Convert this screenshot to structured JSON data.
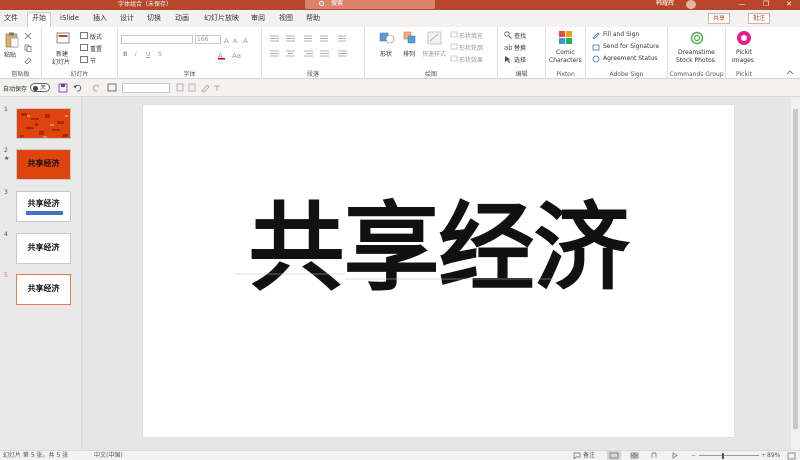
{
  "titlebar": {
    "doc_title": "字体组合（未保存）",
    "search_placeholder": "搜索",
    "user": "韩耀辉",
    "minimize": "—",
    "restore": "❐",
    "close": "✕"
  },
  "menu": {
    "tabs": [
      "文件",
      "开始",
      "iSlide",
      "插入",
      "设计",
      "切换",
      "动画",
      "幻灯片放映",
      "审阅",
      "视图",
      "帮助"
    ],
    "active_index": 1,
    "share": "共享",
    "comment": "批注"
  },
  "ribbon": {
    "clipboard": {
      "paste": "粘贴",
      "label": "剪贴板"
    },
    "slides": {
      "new_slide": "新建",
      "new_slide2": "幻灯片",
      "layout": "版式",
      "reset": "重置",
      "section": "节",
      "label": "幻灯片"
    },
    "font": {
      "size": "166",
      "bold": "B",
      "italic": "I",
      "underline": "U",
      "strike": "S",
      "label": "字体"
    },
    "paragraph": {
      "label": "段落"
    },
    "drawing": {
      "shapes": "形状",
      "arrange": "排列",
      "quick_styles": "快速样式",
      "fill": "形状填充",
      "outline": "形状轮廓",
      "effects": "形状效果",
      "label": "绘图"
    },
    "editing": {
      "find": "查找",
      "replace": "替换",
      "select": "选择",
      "label": "编辑"
    },
    "pixton": {
      "comic": "Comic",
      "characters": "Characters",
      "label": "Pixton"
    },
    "adobe_sign": {
      "fill_sign": "Fill and Sign",
      "send": "Send for Signature",
      "status": "Agreement Status",
      "label": "Adobe Sign"
    },
    "commands": {
      "dreamstime": "Dreamstime",
      "stock": "Stock Photos",
      "label": "Commands Group"
    },
    "pickit": {
      "pickit": "Pickit",
      "images": "Images",
      "label": "Pickit"
    }
  },
  "qat": {
    "autosave": "自动保存",
    "toggle": "关"
  },
  "slides": [
    {
      "number": "1",
      "text": "",
      "bg": "#e0440e"
    },
    {
      "number": "2",
      "text": "共享经济",
      "bg": "#e0440e",
      "star": "★"
    },
    {
      "number": "3",
      "text": "共享经济",
      "bg": "#ffffff",
      "bar": "#4472c4"
    },
    {
      "number": "4",
      "text": "共享经济",
      "bg": "#ffffff"
    },
    {
      "number": "5",
      "text": "共享经济",
      "bg": "#ffffff",
      "selected": true
    }
  ],
  "slide": {
    "title": "共享经济"
  },
  "statusbar": {
    "slide_info": "幻灯片 第 5 张，共 5 张",
    "language": "中文(中国)",
    "notes": "备注",
    "zoom": "89%"
  },
  "colors": {
    "accent": "#b7472a",
    "slide_orange": "#e0440e"
  }
}
